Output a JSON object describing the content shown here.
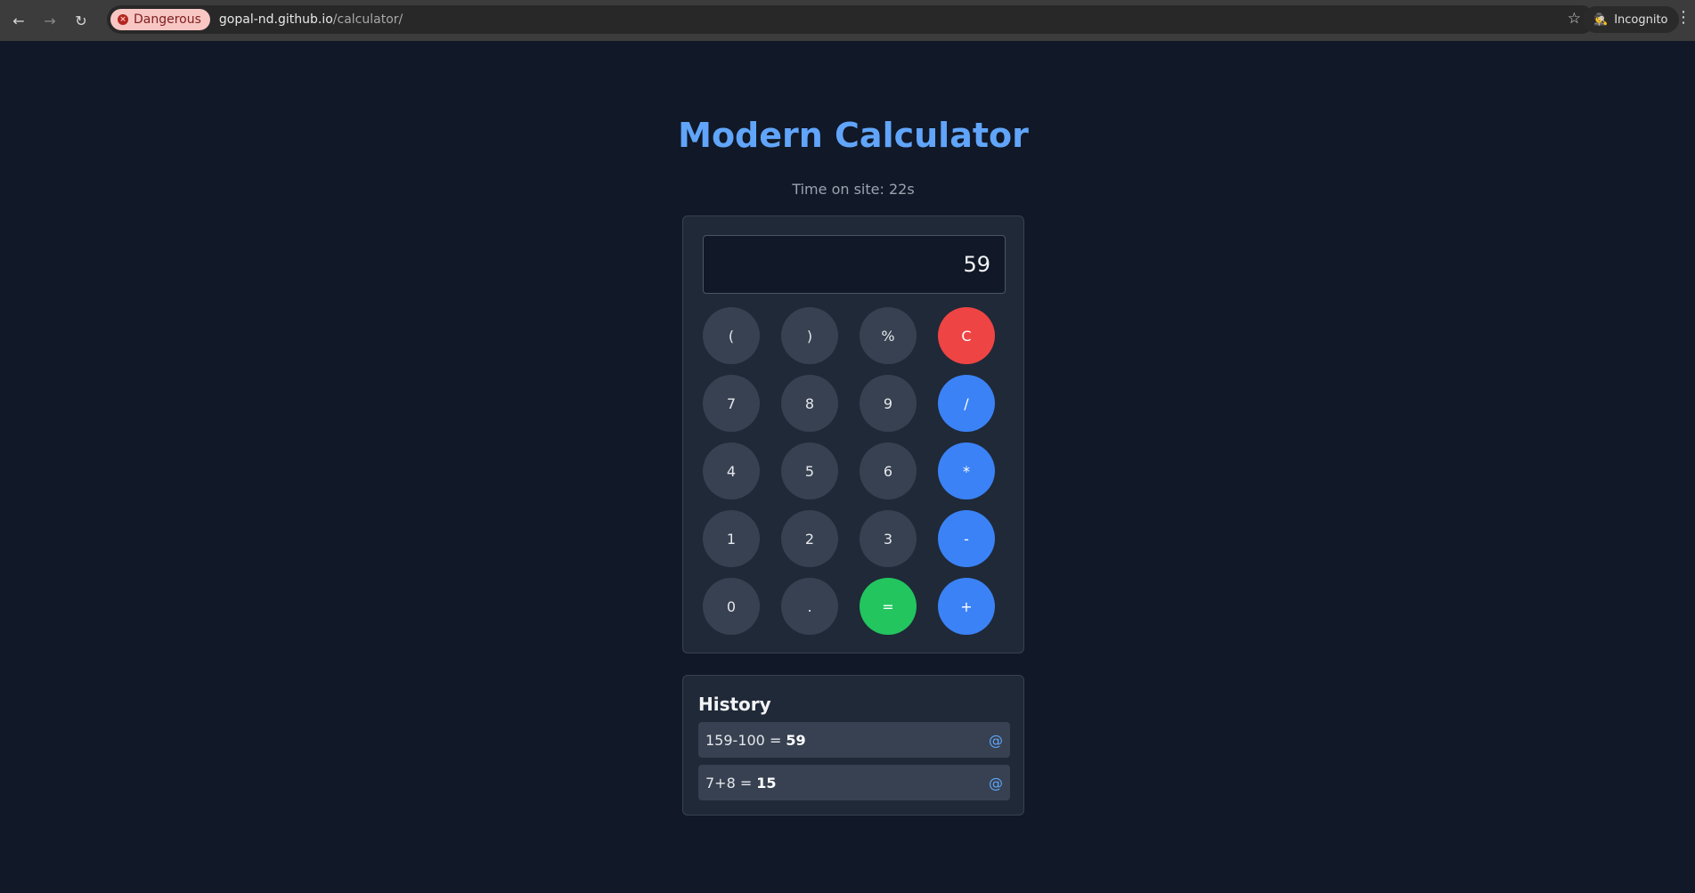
{
  "browser": {
    "security_label": "Dangerous",
    "url_host": "gopal-nd.github.io",
    "url_path": "/calculator/",
    "profile_label": "Incognito"
  },
  "page": {
    "title": "Modern Calculator",
    "timer_text": "Time on site: 22s"
  },
  "calculator": {
    "display_value": "59",
    "keys": [
      {
        "label": "(",
        "kind": "func"
      },
      {
        "label": ")",
        "kind": "func"
      },
      {
        "label": "%",
        "kind": "func"
      },
      {
        "label": "C",
        "kind": "clear"
      },
      {
        "label": "7",
        "kind": "digit"
      },
      {
        "label": "8",
        "kind": "digit"
      },
      {
        "label": "9",
        "kind": "digit"
      },
      {
        "label": "/",
        "kind": "op"
      },
      {
        "label": "4",
        "kind": "digit"
      },
      {
        "label": "5",
        "kind": "digit"
      },
      {
        "label": "6",
        "kind": "digit"
      },
      {
        "label": "*",
        "kind": "op"
      },
      {
        "label": "1",
        "kind": "digit"
      },
      {
        "label": "2",
        "kind": "digit"
      },
      {
        "label": "3",
        "kind": "digit"
      },
      {
        "label": "-",
        "kind": "op"
      },
      {
        "label": "0",
        "kind": "digit"
      },
      {
        "label": ".",
        "kind": "digit"
      },
      {
        "label": "=",
        "kind": "equals"
      },
      {
        "label": "+",
        "kind": "op"
      }
    ]
  },
  "history": {
    "title": "History",
    "recall_symbol": "@",
    "items": [
      {
        "expression": "159-100 =",
        "result": "59"
      },
      {
        "expression": "7+8 =",
        "result": "15"
      }
    ]
  },
  "colors": {
    "accent": "#60a5fa",
    "operator": "#3b82f6",
    "clear": "#ef4444",
    "equals": "#22c55e",
    "background": "#111827"
  }
}
